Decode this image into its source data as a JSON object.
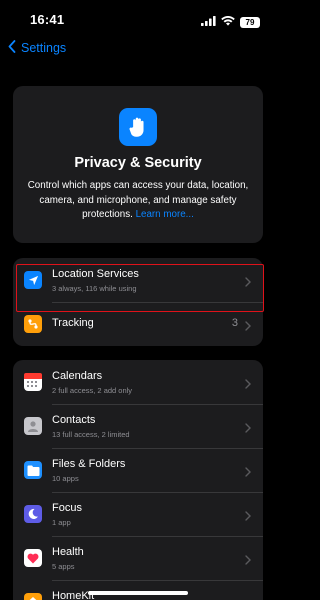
{
  "status_bar": {
    "time": "16:41",
    "battery": "79"
  },
  "nav": {
    "back_label": "Settings"
  },
  "header": {
    "title": "Privacy & Security",
    "description": "Control which apps can access your data, location, camera, and microphone, and manage safety protections.",
    "learn_more": "Learn more..."
  },
  "group1": [
    {
      "title": "Location Services",
      "subtitle": "3 always, 116 while using",
      "icon": "location-arrow-icon",
      "color": "#0a84ff"
    },
    {
      "title": "Tracking",
      "value": "3",
      "icon": "tracking-icon",
      "color": "#ff9f0a"
    }
  ],
  "group2": [
    {
      "title": "Calendars",
      "subtitle": "2 full access, 2 add only",
      "icon": "calendar-icon",
      "color": "#ffffff"
    },
    {
      "title": "Contacts",
      "subtitle": "13 full access, 2 limited",
      "icon": "contacts-icon",
      "color": "#b0b0b5"
    },
    {
      "title": "Files & Folders",
      "subtitle": "10 apps",
      "icon": "folder-icon",
      "color": "#1e90ff"
    },
    {
      "title": "Focus",
      "subtitle": "1 app",
      "icon": "moon-icon",
      "color": "#5e5ce6"
    },
    {
      "title": "Health",
      "subtitle": "5 apps",
      "icon": "heart-icon",
      "color": "#ffffff"
    },
    {
      "title": "HomeKit",
      "icon": "home-icon",
      "color": "#ff9f0a"
    }
  ]
}
